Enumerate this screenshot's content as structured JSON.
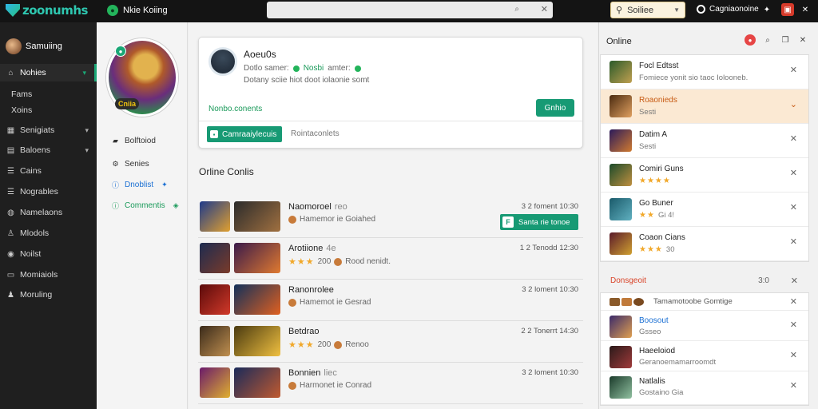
{
  "topbar": {
    "logo_text": "zoonumhs",
    "app_title": "Nkie Koiing",
    "sort_label": "Soiliee",
    "account_label": "Cagniaonoine"
  },
  "sidebar": {
    "user_name": "Samuiing",
    "items": [
      {
        "label": "Nohies",
        "icon": "home-icon",
        "chevron": true,
        "active": true
      },
      {
        "label": "Fams",
        "icon": "none",
        "chevron": false
      },
      {
        "label": "Xoins",
        "icon": "none",
        "chevron": false
      },
      {
        "label": "Senigiats",
        "icon": "grid-icon",
        "chevron": true
      },
      {
        "label": "Baloens",
        "icon": "folder-icon",
        "chevron": true
      },
      {
        "label": "Cains",
        "icon": "list-icon",
        "chevron": false
      },
      {
        "label": "Nogrables",
        "icon": "list-icon",
        "chevron": false
      },
      {
        "label": "Namelaons",
        "icon": "globe-icon",
        "chevron": false
      },
      {
        "label": "Mlodols",
        "icon": "user-icon",
        "chevron": false
      },
      {
        "label": "Noilst",
        "icon": "circle-icon",
        "chevron": false
      },
      {
        "label": "Momiaiols",
        "icon": "doc-icon",
        "chevron": false
      },
      {
        "label": "Moruling",
        "icon": "person-icon",
        "chevron": false
      }
    ]
  },
  "profile": {
    "avatar_tag": "Cniia",
    "items": [
      {
        "label": "Bolftoiod",
        "style": "normal",
        "icon": "lock-icon"
      },
      {
        "label": "Senies",
        "style": "normal",
        "icon": "gear-icon"
      },
      {
        "label": "Dnoblist",
        "style": "blue",
        "icon": "info-icon"
      },
      {
        "label": "Commentis",
        "style": "green",
        "icon": "info-icon"
      }
    ]
  },
  "card": {
    "name": "Aoeu0s",
    "status_prefix": "Dotlo samer:",
    "status_online": "Nosbi",
    "status_suffix": "amter:",
    "description": "Dotany sciie hiot doot iolaonie somt",
    "link": "Nonbo.conents",
    "button": "Gnhio",
    "tab_active": "Camraaiylecuis",
    "tab_other": "Rointaconlets"
  },
  "main": {
    "section_title": "Orline Conlis",
    "games": [
      {
        "title": "Naomoroel",
        "title_extra": "reo",
        "sub_type": "text",
        "sub": "Hamemor ie Goiahed",
        "time": "3 2 foment 10:30",
        "button": "Santa rie tonoe"
      },
      {
        "title": "Arotiione",
        "title_extra": "4e",
        "sub_type": "stars",
        "stars": "★★★",
        "sub_num": "200",
        "sub": "Rood nenidt.",
        "time": "1 2 Tenodd 12:30",
        "button": ""
      },
      {
        "title": "Ranonrolee",
        "title_extra": "",
        "sub_type": "text",
        "sub": "Hamemot ie Gesrad",
        "time": "3 2 loment 10:30",
        "button": ""
      },
      {
        "title": "Betdrao",
        "title_extra": "",
        "sub_type": "stars",
        "stars": "★★★",
        "sub_num": "200",
        "sub": "Renoo",
        "time": "2 2 Tonerrt 14:30",
        "button": ""
      },
      {
        "title": "Bonnien",
        "title_extra": "liec",
        "sub_type": "text",
        "sub": "Harmonet ie Conrad",
        "time": "3 2 loment 10:30",
        "button": ""
      }
    ]
  },
  "right": {
    "title": "Online",
    "items": [
      {
        "title": "Focl Edtsst",
        "sub": "Fomiece yonit sio taoc Iolooneb.",
        "type": "text",
        "trailing": "close",
        "highlight": false
      },
      {
        "title": "Roaonieds",
        "sub": "Sesti",
        "type": "text",
        "trailing": "chevron",
        "highlight": true
      },
      {
        "title": "Datim A",
        "sub": "Sesti",
        "type": "text",
        "trailing": "close",
        "highlight": false
      },
      {
        "title": "Comiri Guns",
        "stars": "★★★★",
        "sub": "",
        "type": "stars",
        "trailing": "close",
        "highlight": false
      },
      {
        "title": "Go Buner",
        "stars": "★★",
        "sub": "Gi 4!",
        "type": "stars",
        "trailing": "close",
        "highlight": false
      },
      {
        "title": "Coaon Cians",
        "stars": "★★★",
        "sub": "30",
        "type": "stars",
        "trailing": "close",
        "highlight": false
      }
    ],
    "section_label": "Donsgeoit",
    "section_num": "3:0",
    "section2": [
      {
        "title": "Tamamotoobe Gomtige",
        "sub": "",
        "layout": "inline"
      },
      {
        "title": "Boosout",
        "sub": "Gsseo",
        "layout": "stack",
        "title_blue": true
      },
      {
        "title": "Haeeloiod",
        "sub": "Geranoemamarroomdt",
        "layout": "stack"
      },
      {
        "title": "Natlalis",
        "sub": "Gostaino Gia",
        "layout": "stack"
      }
    ]
  },
  "colors": {
    "accent_green": "#179a74",
    "highlight": "#fbe9d3",
    "red": "#e64545"
  }
}
